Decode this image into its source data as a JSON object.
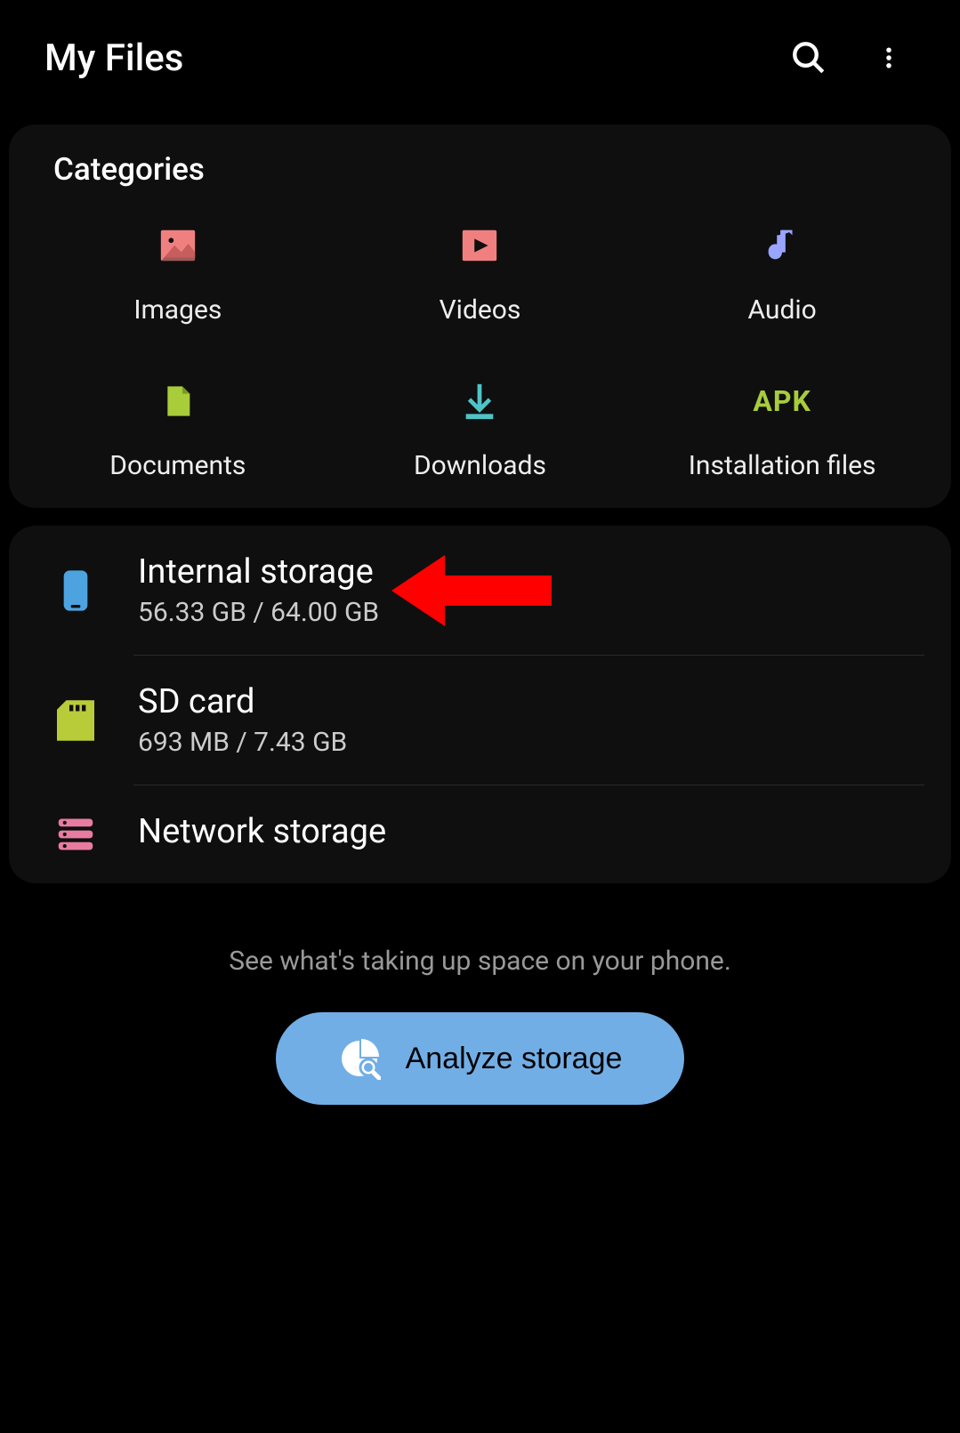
{
  "header": {
    "title": "My Files"
  },
  "categories": {
    "title": "Categories",
    "items": [
      {
        "label": "Images"
      },
      {
        "label": "Videos"
      },
      {
        "label": "Audio"
      },
      {
        "label": "Documents"
      },
      {
        "label": "Downloads"
      },
      {
        "label": "Installation files"
      }
    ]
  },
  "storage": {
    "items": [
      {
        "title": "Internal storage",
        "sub": "56.33 GB / 64.00 GB"
      },
      {
        "title": "SD card",
        "sub": "693 MB / 7.43 GB"
      },
      {
        "title": "Network storage"
      }
    ]
  },
  "footer": {
    "text": "See what's taking up space on your phone.",
    "button": "Analyze storage"
  }
}
